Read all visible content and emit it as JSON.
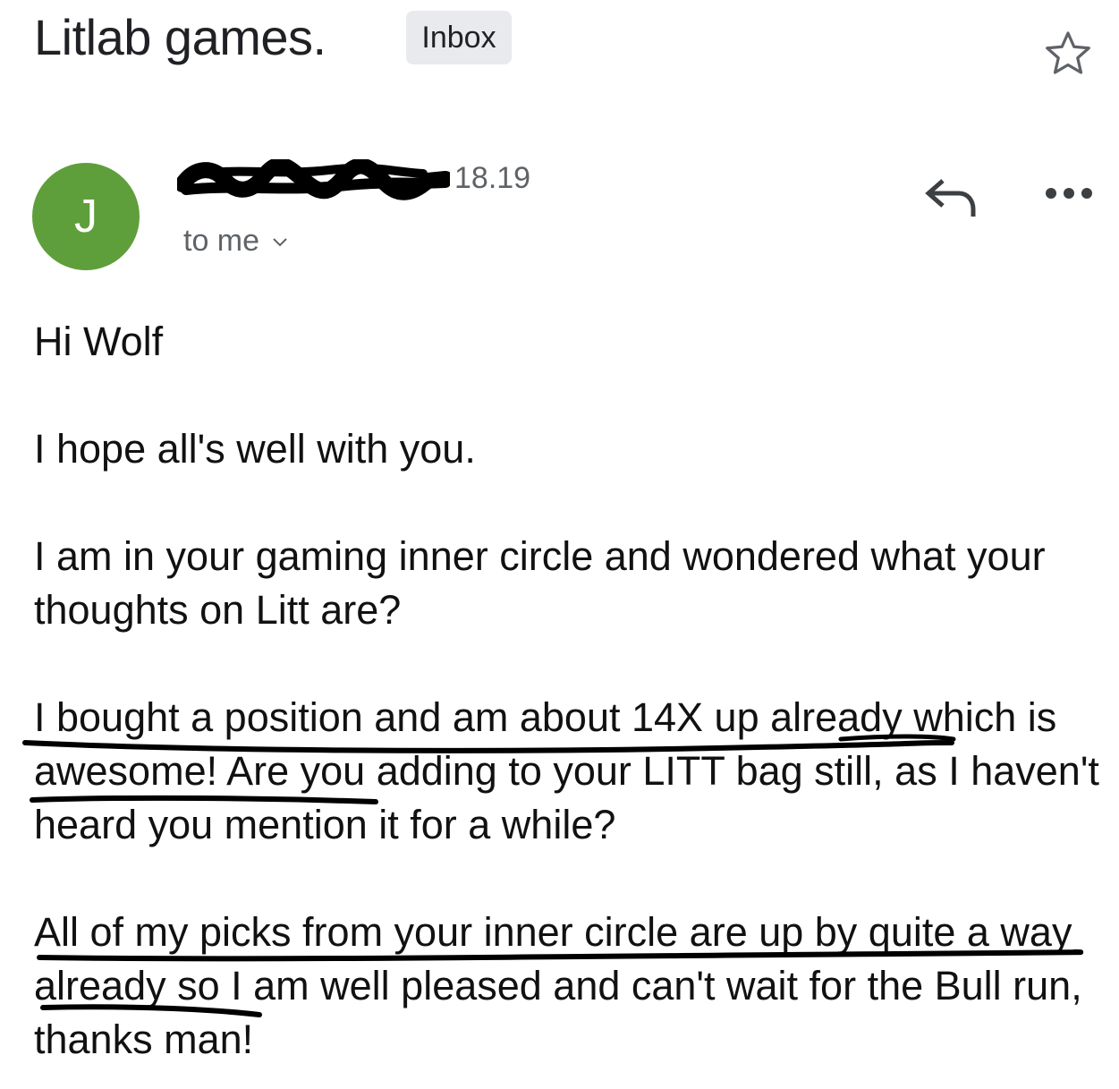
{
  "email": {
    "subject": "Litlab games.",
    "label": "Inbox",
    "avatar_letter": "J",
    "avatar_color": "#5f9f3b",
    "time": "18.19",
    "recipients": "to me",
    "paragraphs": [
      "Hi Wolf",
      "I hope all's well with you.",
      "I am in your gaming inner circle and wondered what your thoughts on Litt are?",
      "I bought a position and am about 14X up already which is awesome! Are you adding to your LITT bag still, as I haven't heard you mention it for a while?",
      "All of my picks from your inner circle are up by quite a way already so I am well pleased and can't wait for the Bull run, thanks man!"
    ]
  },
  "icons": {
    "star": "star-outline-icon",
    "reply": "reply-icon",
    "more": "more-horizontal-icon",
    "chevron": "chevron-down-icon"
  }
}
